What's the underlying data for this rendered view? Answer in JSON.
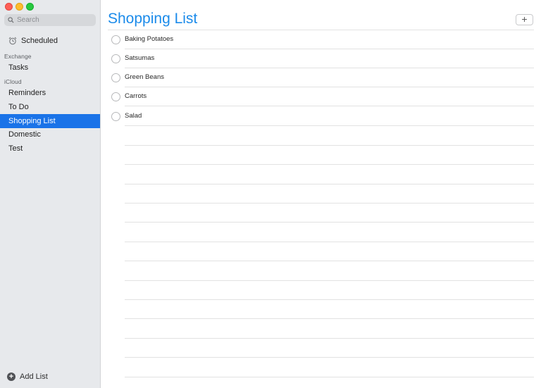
{
  "sidebar": {
    "search": {
      "placeholder": "Search",
      "icon": "magnifier-icon"
    },
    "scheduled": {
      "label": "Scheduled",
      "icon": "alarm-clock-icon"
    },
    "groups": [
      {
        "header": "Exchange",
        "items": [
          {
            "label": "Tasks"
          }
        ]
      },
      {
        "header": "iCloud",
        "items": [
          {
            "label": "Reminders"
          },
          {
            "label": "To Do"
          },
          {
            "label": "Shopping List",
            "selected": true
          },
          {
            "label": "Domestic"
          },
          {
            "label": "Test"
          }
        ]
      }
    ],
    "add_list": {
      "label": "Add List",
      "icon": "plus-circle-icon"
    }
  },
  "main": {
    "title": "Shopping List",
    "add_button": "+",
    "items": [
      {
        "label": "Baking Potatoes",
        "completed": false
      },
      {
        "label": "Satsumas",
        "completed": false
      },
      {
        "label": "Green Beans",
        "completed": false
      },
      {
        "label": "Carrots",
        "completed": false
      },
      {
        "label": "Salad",
        "completed": false
      }
    ]
  },
  "colors": {
    "accent": "#1a73e8",
    "title": "#1b8bea",
    "sidebar_bg": "#e7e9ec"
  }
}
